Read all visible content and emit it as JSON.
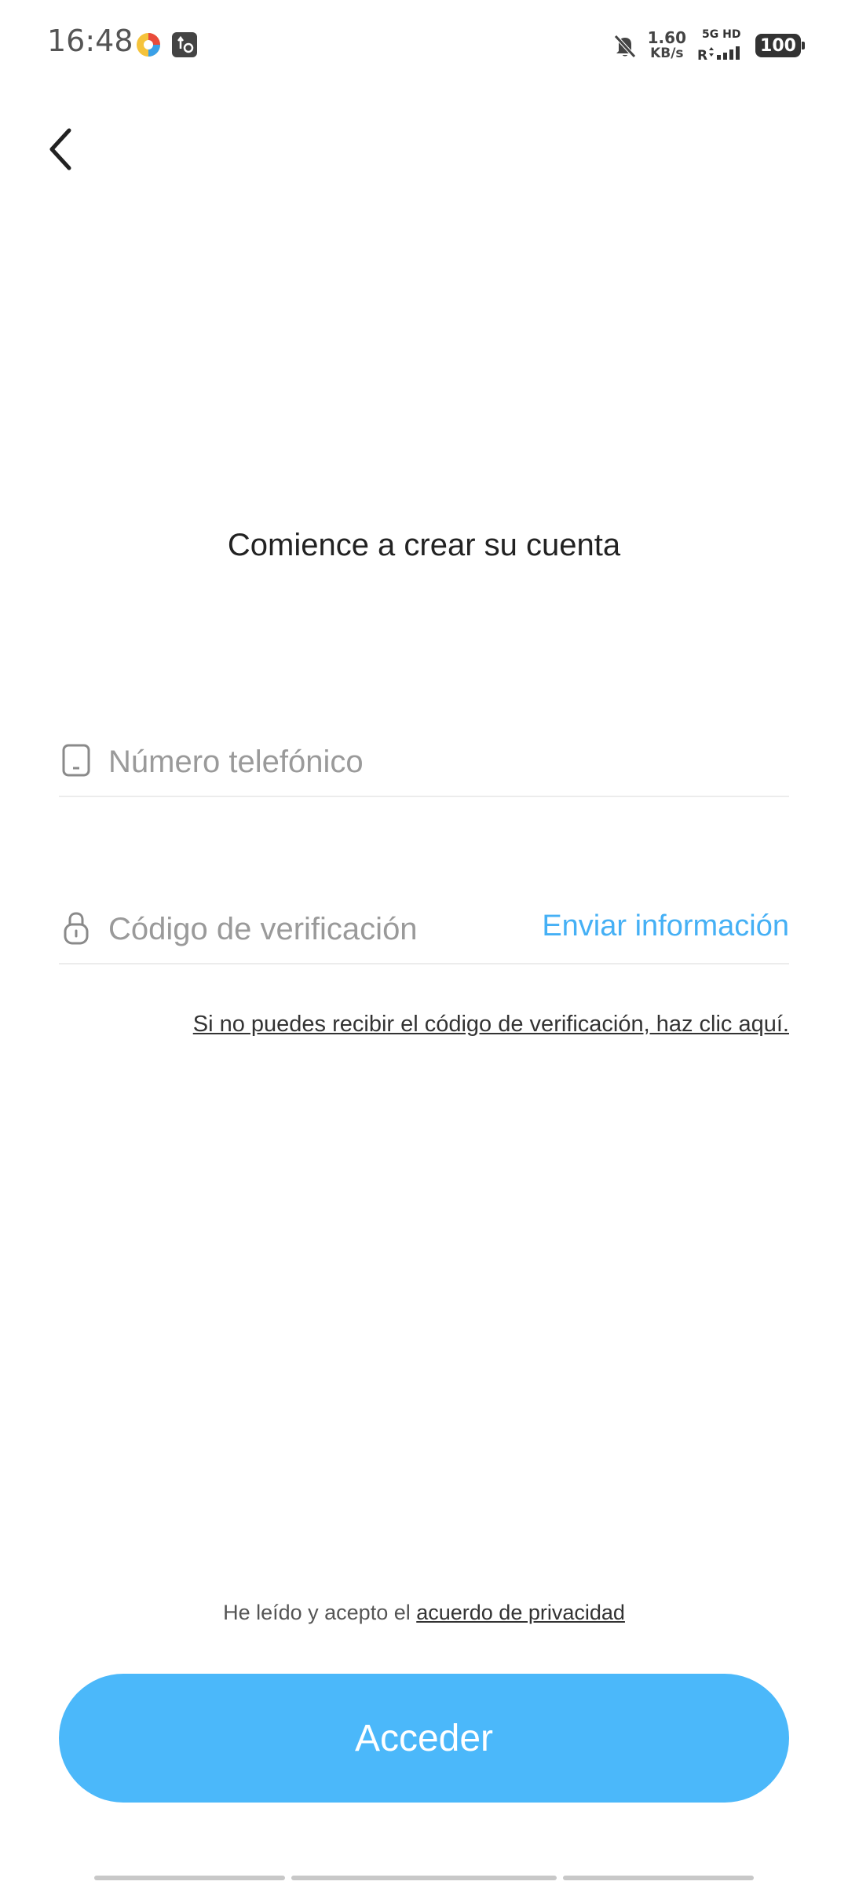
{
  "status_bar": {
    "time": "16:48",
    "net_speed_value": "1.60",
    "net_speed_unit": "KB/s",
    "network_label": "5G HD",
    "battery": "100",
    "icons": [
      "browser-app-icon",
      "usb-debug-icon",
      "bell-muted-icon",
      "signal-icon",
      "battery-icon"
    ]
  },
  "header": {
    "back_icon": "chevron-left-icon"
  },
  "main": {
    "title": "Comience a crear su cuenta",
    "phone_field": {
      "placeholder": "Número telefónico",
      "value": "",
      "icon": "phone-icon"
    },
    "code_field": {
      "placeholder": "Código de verificación",
      "value": "",
      "icon": "lock-icon",
      "send_label": "Enviar información"
    },
    "help_link": "Si no puedes recibir el código de verificación, haz clic aquí."
  },
  "footer": {
    "privacy_prefix": "He leído y acepto el ",
    "privacy_link": "acuerdo de privacidad",
    "login_label": "Acceder"
  },
  "colors": {
    "accent": "#4bb8fa",
    "link": "#45b0f5"
  }
}
